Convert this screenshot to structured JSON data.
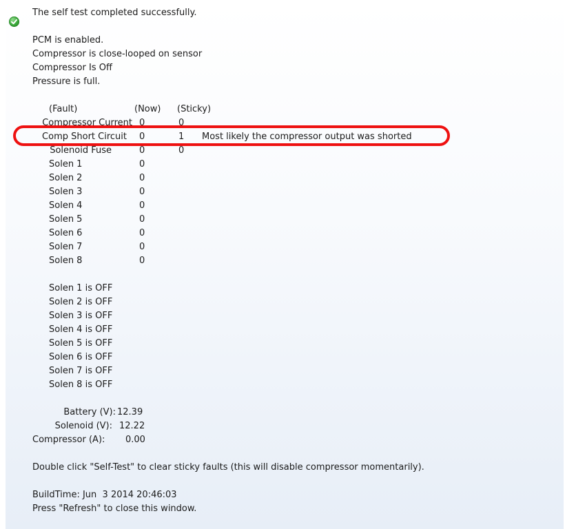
{
  "status": {
    "icon": "check-circle-icon",
    "message": "The self test completed successfully."
  },
  "state_lines": [
    "PCM is enabled.",
    "Compressor is close-looped on sensor",
    "Compressor Is Off",
    "Pressure is full."
  ],
  "fault_table": {
    "headers": {
      "fault": "(Fault)",
      "now": "(Now)",
      "sticky": "(Sticky)"
    },
    "rows": [
      {
        "name": "Compressor Current",
        "now": "0",
        "sticky": "0",
        "note": ""
      },
      {
        "name": "Comp Short Circuit",
        "now": "0",
        "sticky": "1",
        "note": "Most likely the compressor output was shorted"
      },
      {
        "name": "Solenoid Fuse",
        "now": "0",
        "sticky": "0",
        "note": ""
      },
      {
        "name": "Solen 1",
        "now": "0",
        "sticky": "",
        "note": ""
      },
      {
        "name": "Solen 2",
        "now": "0",
        "sticky": "",
        "note": ""
      },
      {
        "name": "Solen 3",
        "now": "0",
        "sticky": "",
        "note": ""
      },
      {
        "name": "Solen 4",
        "now": "0",
        "sticky": "",
        "note": ""
      },
      {
        "name": "Solen 5",
        "now": "0",
        "sticky": "",
        "note": ""
      },
      {
        "name": "Solen 6",
        "now": "0",
        "sticky": "",
        "note": ""
      },
      {
        "name": "Solen 7",
        "now": "0",
        "sticky": "",
        "note": ""
      },
      {
        "name": "Solen 8",
        "now": "0",
        "sticky": "",
        "note": ""
      }
    ]
  },
  "solenoid_states": [
    "Solen 1 is OFF",
    "Solen 2 is OFF",
    "Solen 3 is OFF",
    "Solen 4 is OFF",
    "Solen 5 is OFF",
    "Solen 6 is OFF",
    "Solen 7 is OFF",
    "Solen 8 is OFF"
  ],
  "measurements": [
    {
      "label": "Battery (V):",
      "value": "12.39"
    },
    {
      "label": "Solenoid (V):",
      "value": "12.22"
    },
    {
      "label": "Compressor (A):",
      "value": "0.00"
    }
  ],
  "instruction": "Double click \"Self-Test\" to clear sticky faults (this will disable compressor momentarily).",
  "build_time": "BuildTime: Jun  3 2014 20:46:03",
  "refresh_hint": "Press \"Refresh\" to close this window.",
  "colors": {
    "highlight": "#ee1111",
    "ok_icon": "#3aa83a"
  }
}
